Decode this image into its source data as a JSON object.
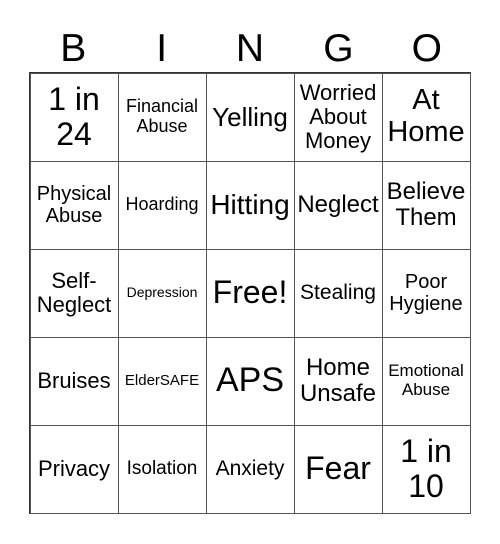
{
  "header": [
    "B",
    "I",
    "N",
    "G",
    "O"
  ],
  "cells": [
    [
      "1 in\n24",
      "Financial\nAbuse",
      "Yelling",
      "Worried\nAbout\nMoney",
      "At\nHome"
    ],
    [
      "Physical\nAbuse",
      "Hoarding",
      "Hitting",
      "Neglect",
      "Believe\nThem"
    ],
    [
      "Self-\nNeglect",
      "Depression",
      "Free!",
      "Stealing",
      "Poor\nHygiene"
    ],
    [
      "Bruises",
      "ElderSAFE",
      "APS",
      "Home\nUnsafe",
      "Emotional\nAbuse"
    ],
    [
      "Privacy",
      "Isolation",
      "Anxiety",
      "Fear",
      "1 in\n10"
    ]
  ]
}
